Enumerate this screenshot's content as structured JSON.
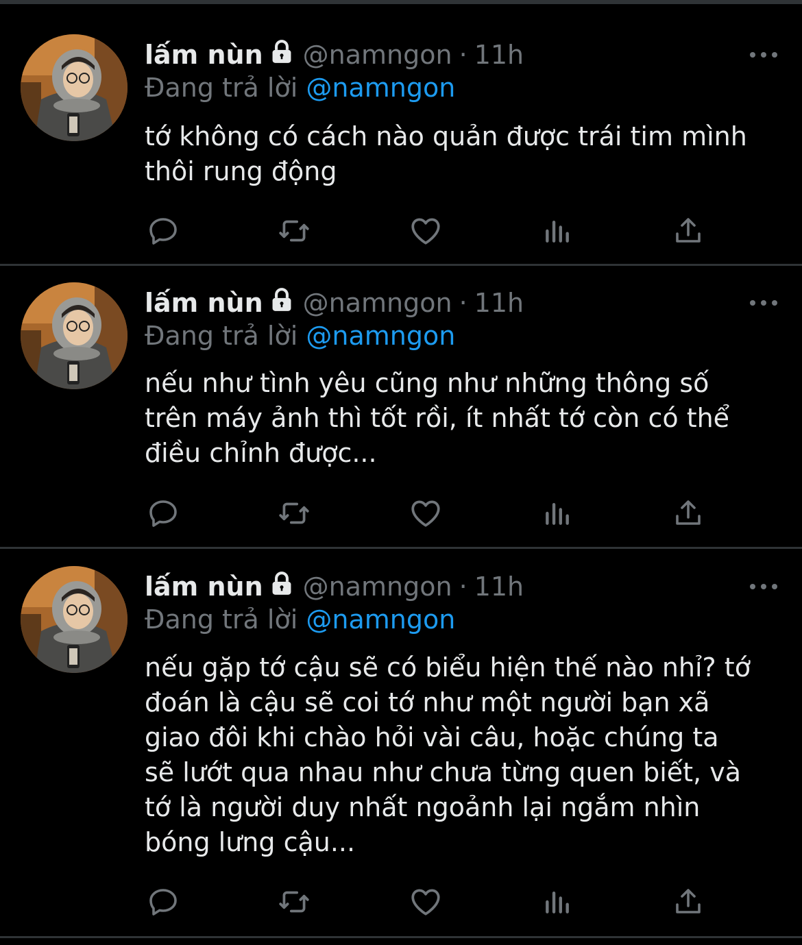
{
  "colors": {
    "background": "#000000",
    "text": "#e7e9ea",
    "secondary": "#71767b",
    "accent": "#1d9bf0",
    "divider": "#2f3336"
  },
  "tweets": [
    {
      "display_name": "lấm nùn",
      "handle": "@namngon",
      "separator": "·",
      "time": "11h",
      "reply_prefix": "Đang trả lời",
      "reply_to": "@namngon",
      "text": "tớ không có cách nào quản được trái tim mình\nthôi rung động",
      "icons": [
        "lock-icon",
        "more-icon",
        "reply-icon",
        "retweet-icon",
        "like-icon",
        "analytics-icon",
        "share-icon"
      ]
    },
    {
      "display_name": "lấm nùn",
      "handle": "@namngon",
      "separator": "·",
      "time": "11h",
      "reply_prefix": "Đang trả lời",
      "reply_to": "@namngon",
      "text": "nếu như tình yêu cũng như những thông số\ntrên máy ảnh thì tốt rồi, ít nhất tớ còn có thể\nđiều chỉnh được...",
      "icons": [
        "lock-icon",
        "more-icon",
        "reply-icon",
        "retweet-icon",
        "like-icon",
        "analytics-icon",
        "share-icon"
      ]
    },
    {
      "display_name": "lấm nùn",
      "handle": "@namngon",
      "separator": "·",
      "time": "11h",
      "reply_prefix": "Đang trả lời",
      "reply_to": "@namngon",
      "text": "nếu gặp tớ cậu sẽ có biểu hiện thế nào nhỉ? tớ\nđoán là cậu sẽ coi tớ như một người bạn xã\ngiao đôi khi chào hỏi vài câu, hoặc chúng ta\nsẽ lướt qua nhau như chưa từng quen biết, và\ntớ là người duy nhất ngoảnh lại ngắm nhìn\nbóng lưng cậu...",
      "icons": [
        "lock-icon",
        "more-icon",
        "reply-icon",
        "retweet-icon",
        "like-icon",
        "analytics-icon",
        "share-icon"
      ]
    }
  ]
}
